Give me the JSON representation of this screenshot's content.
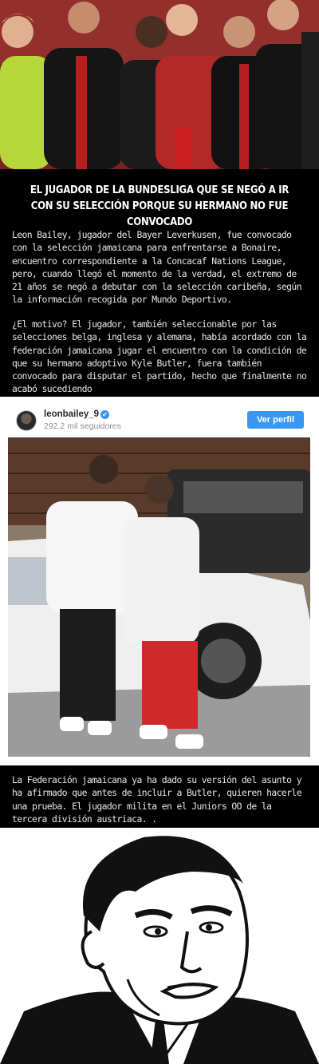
{
  "article": {
    "headline": "EL JUGADOR DE LA BUNDESLIGA QUE SE NEGÓ A IR CON SU SELECCIÓN PORQUE SU HERMANO NO FUE CONVOCADO",
    "paragraph1": "Leon Bailey, jugador del Bayer Leverkusen, fue convocado con la selección jamaicana para enfrentarse a Bonaire, encuentro correspondiente a la Concacaf Nations League, pero, cuando llegó el momento de la verdad, el extremo de 21 años se negó a debutar con la selección caribeña, según la información recogida por Mundo Deportivo.",
    "paragraph2": "¿El motivo? El jugador, también seleccionable por las selecciones belga, inglesa y alemana, había acordado con la federación jamaicana jugar el encuentro con la condición de que su hermano adoptivo Kyle Butler, fuera también convocado para disputar el partido, hecho que finalmente no acabó sucediendo",
    "paragraph3": "La Federación jamaicana ya ha dado su versión del asunto y ha afirmado que antes de incluir a Butler, quieren hacerle una prueba. El jugador milita en el Juniors OO de la tercera división austriaca. ."
  },
  "instagram": {
    "username": "leonbailey_9",
    "verified_icon": "✔",
    "followers": "292.2 mil seguidores",
    "button_label": "Ver perfil",
    "accent": "#3897f0"
  }
}
